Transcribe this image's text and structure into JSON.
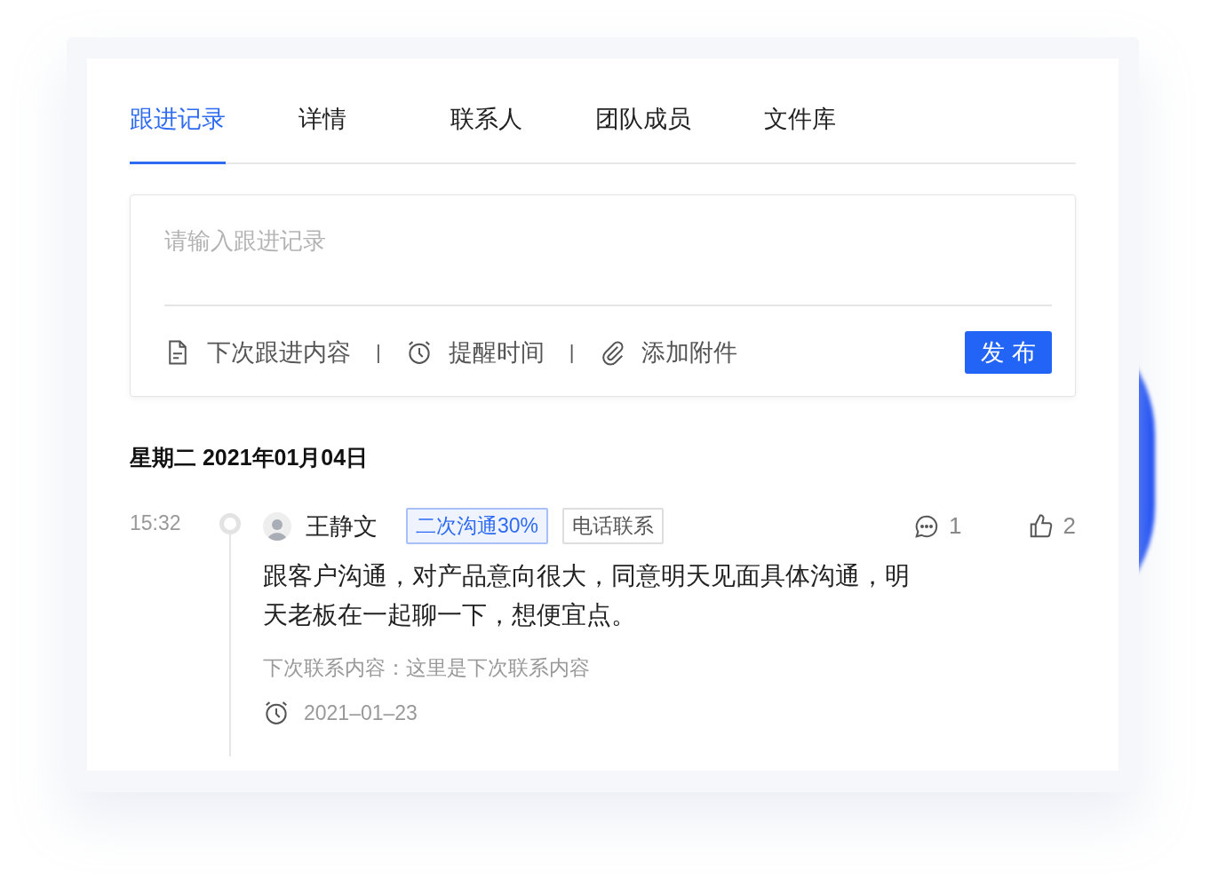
{
  "tabs": [
    {
      "label": "跟进记录",
      "selected": true
    },
    {
      "label": "详情",
      "selected": false
    },
    {
      "label": "联系人",
      "selected": false
    },
    {
      "label": "团队成员",
      "selected": false
    },
    {
      "label": "文件库",
      "selected": false
    }
  ],
  "composer": {
    "placeholder": "请输入跟进记录",
    "tools": [
      {
        "kind": "document",
        "label": "下次跟进内容"
      },
      {
        "kind": "alarm",
        "label": "提醒时间"
      },
      {
        "kind": "clip",
        "label": "添加附件"
      }
    ],
    "separator": "|",
    "button": "发 布"
  },
  "date_heading": "星期二 2021年01月04日",
  "entries": [
    {
      "time": "15:32",
      "author": "王静文",
      "tags": [
        {
          "label": "二次沟通30%",
          "kind": "primary"
        },
        {
          "label": "电话联系",
          "kind": "plain"
        }
      ],
      "comments": "1",
      "likes": "2",
      "content": "跟客户沟通，对产品意向很大，同意明天见面具体沟通，明天老板在一起聊一下，想便宜点。",
      "next_contact": "下次联系内容：这里是下次联系内容",
      "reminder": "2021–01–23"
    }
  ]
}
